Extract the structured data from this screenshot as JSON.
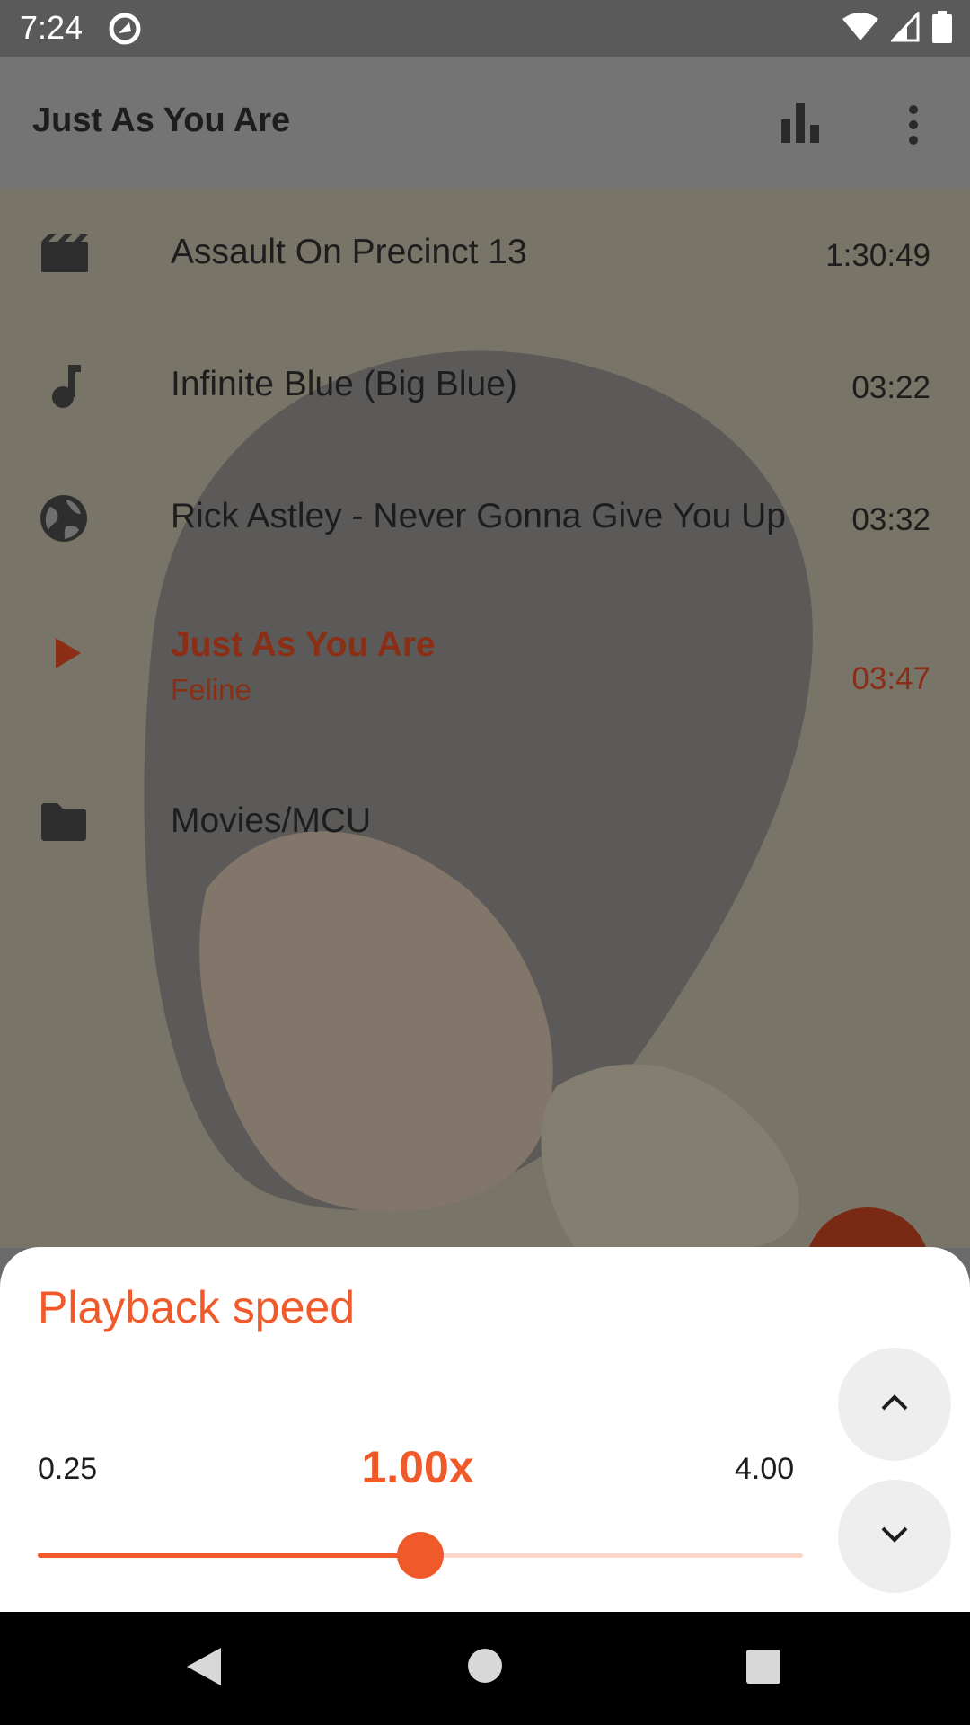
{
  "status_bar": {
    "time": "7:24",
    "icons": [
      "app-notification-icon",
      "wifi-icon",
      "signal-icon",
      "battery-icon"
    ]
  },
  "app_bar": {
    "title": "Just As You Are",
    "actions": [
      "equalizer-icon",
      "more-vert-icon"
    ]
  },
  "playlist": {
    "items": [
      {
        "icon": "movie-icon",
        "title": "Assault On Precinct 13",
        "duration": "1:30:49"
      },
      {
        "icon": "music-note-icon",
        "title": "Infinite Blue (Big Blue)",
        "duration": "03:22"
      },
      {
        "icon": "globe-icon",
        "title": "Rick Astley - Never Gonna Give You Up",
        "duration": "03:32"
      },
      {
        "icon": "play-icon",
        "title": "Just As You Are",
        "subtitle": "Feline",
        "duration": "03:47",
        "current": true
      },
      {
        "icon": "folder-icon",
        "title": "Movies/MCU",
        "duration": ""
      }
    ]
  },
  "playback_speed": {
    "title": "Playback speed",
    "min_label": "0.25",
    "max_label": "4.00",
    "value_label": "1.00x",
    "slider_fraction": 0.5
  },
  "colors": {
    "accent": "#f05a2a",
    "current_item": "#8a2e16"
  }
}
